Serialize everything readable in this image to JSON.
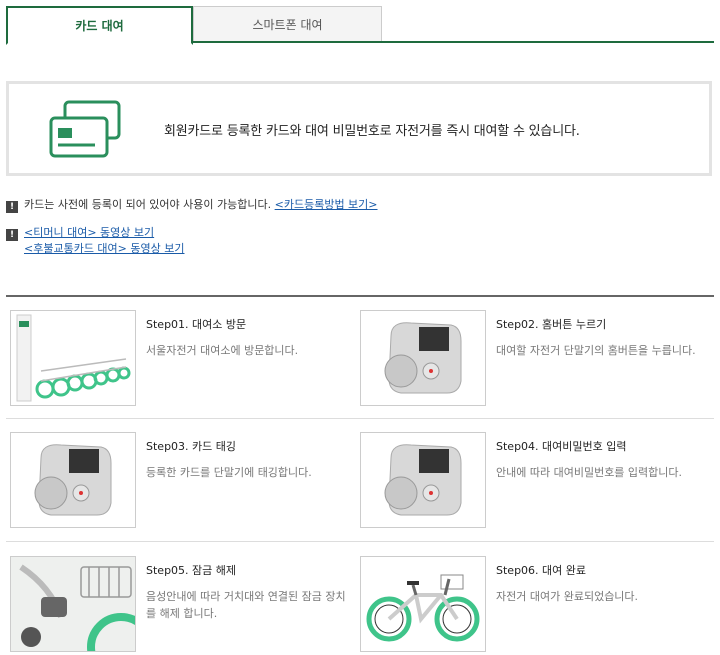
{
  "tabs": [
    {
      "label": "카드 대여",
      "active": true
    },
    {
      "label": "스마트폰 대여",
      "active": false
    }
  ],
  "info": {
    "text": "회원카드로 등록한 카드와 대여 비밀번호로 자전거를 즉시 대여할 수 있습니다.",
    "icon": "card-icon"
  },
  "notes": {
    "note1_text": "카드는 사전에 등록이 되어 있어야 사용이 가능합니다.",
    "note1_link": "<카드등록방법 보기>",
    "note2_link1": "<티머니 대여> 동영상 보기",
    "note2_link2": "<후불교통카드 대여> 동영상 보기"
  },
  "steps": [
    {
      "title": "Step01. 대여소 방문",
      "desc": "서울자전거 대여소에 방문합니다."
    },
    {
      "title": "Step02. 홈버튼 누르기",
      "desc": "대여할 자전거 단말기의 홈버튼을 누릅니다."
    },
    {
      "title": "Step03. 카드 태깅",
      "desc": "등록한 카드를 단말기에 태깅합니다."
    },
    {
      "title": "Step04. 대여비밀번호 입력",
      "desc": "안내에 따라 대여비밀번호를 입력합니다."
    },
    {
      "title": "Step05. 잠금 해제",
      "desc": "음성안내에 따라 거치대와 연결된 잠금 장치를 해제 합니다."
    },
    {
      "title": "Step06. 대여 완료",
      "desc": "자전거 대여가 완료되었습니다."
    }
  ],
  "colors": {
    "accent": "#1e6b3e",
    "icon_green": "#2a8f5c"
  }
}
